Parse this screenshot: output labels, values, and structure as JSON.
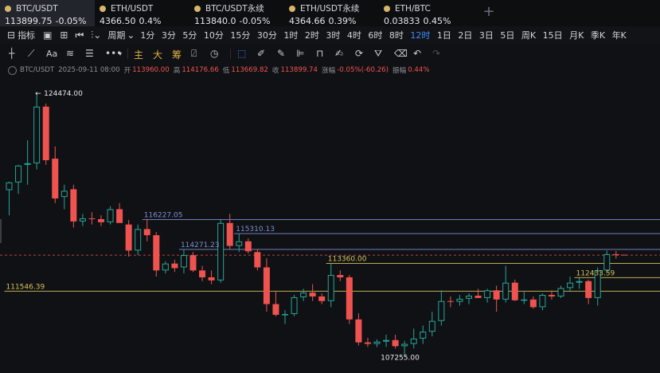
{
  "tickers": [
    {
      "symbol": "BTC/USDT",
      "price": "113899.75",
      "change": "-0.05%",
      "active": true
    },
    {
      "symbol": "ETH/USDT",
      "price": "4366.50",
      "change": "0.4%"
    },
    {
      "symbol": "BTC/USDT永续",
      "price": "113840.0",
      "change": "-0.05%"
    },
    {
      "symbol": "ETH/USDT永续",
      "price": "4364.66",
      "change": "0.39%"
    },
    {
      "symbol": "ETH/BTC",
      "price": "0.03833",
      "change": "0.45%"
    }
  ],
  "toolbar": {
    "indicators_label": "指标",
    "period_label": "周期",
    "intervals": [
      "1分",
      "3分",
      "5分",
      "10分",
      "15分",
      "30分",
      "1时",
      "2时",
      "3时",
      "4时",
      "6时",
      "8时",
      "12时",
      "1日",
      "2日",
      "3日",
      "5日",
      "周K",
      "15日",
      "月K",
      "季K",
      "年K"
    ],
    "active_interval": "12时"
  },
  "drawbar": {
    "text_labels": [
      "主",
      "大",
      "筹"
    ]
  },
  "legend": {
    "symbol": "BTC/USDT",
    "datetime": "2025-09-11 08:00",
    "open_label": "开",
    "open": "113960.00",
    "high_label": "高",
    "high": "114176.66",
    "low_label": "低",
    "low": "113669.82",
    "close_label": "收",
    "close": "113899.74",
    "change_label": "涨幅",
    "change": "-0.05%(-60.26)",
    "amplitude_label": "振幅",
    "amplitude": "0.44%"
  },
  "colors": {
    "up": "#26a69a",
    "down": "#ef5350",
    "accent": "#3f8cff",
    "level_gold": "#d4c15f",
    "level_blue": "#7d8fd1"
  },
  "chart_data": {
    "type": "candlestick",
    "interval": "12时",
    "series": [
      {
        "o": 118150,
        "h": 118700,
        "l": 116500,
        "c": 118650
      },
      {
        "o": 118650,
        "h": 119800,
        "l": 117900,
        "c": 119750
      },
      {
        "o": 119800,
        "h": 121400,
        "l": 118500,
        "c": 119900
      },
      {
        "o": 119900,
        "h": 124474,
        "l": 119500,
        "c": 123600
      },
      {
        "o": 123600,
        "h": 123800,
        "l": 119800,
        "c": 120100
      },
      {
        "o": 120200,
        "h": 121000,
        "l": 117300,
        "c": 117600
      },
      {
        "o": 117700,
        "h": 118500,
        "l": 116900,
        "c": 118100
      },
      {
        "o": 118200,
        "h": 118500,
        "l": 115700,
        "c": 116100
      },
      {
        "o": 116100,
        "h": 116600,
        "l": 115800,
        "c": 116300
      },
      {
        "o": 116300,
        "h": 116700,
        "l": 115900,
        "c": 116250
      },
      {
        "o": 116250,
        "h": 116500,
        "l": 115800,
        "c": 116050
      },
      {
        "o": 116050,
        "h": 117100,
        "l": 115900,
        "c": 116900
      },
      {
        "o": 116900,
        "h": 117300,
        "l": 116300,
        "c": 116000
      },
      {
        "o": 115900,
        "h": 116200,
        "l": 113800,
        "c": 114200
      },
      {
        "o": 114200,
        "h": 115900,
        "l": 113900,
        "c": 115600
      },
      {
        "o": 115600,
        "h": 116227,
        "l": 114800,
        "c": 115200
      },
      {
        "o": 115200,
        "h": 115400,
        "l": 112500,
        "c": 112900
      },
      {
        "o": 112900,
        "h": 113500,
        "l": 112700,
        "c": 113350
      },
      {
        "o": 113350,
        "h": 113600,
        "l": 112800,
        "c": 113050
      },
      {
        "o": 113100,
        "h": 114271,
        "l": 112700,
        "c": 113900
      },
      {
        "o": 113900,
        "h": 114100,
        "l": 112800,
        "c": 112900
      },
      {
        "o": 112900,
        "h": 113200,
        "l": 112200,
        "c": 112450
      },
      {
        "o": 112450,
        "h": 112900,
        "l": 112000,
        "c": 112250
      },
      {
        "o": 112250,
        "h": 116200,
        "l": 112100,
        "c": 116000
      },
      {
        "o": 116000,
        "h": 116600,
        "l": 114300,
        "c": 114500
      },
      {
        "o": 114500,
        "h": 115310,
        "l": 114100,
        "c": 114800
      },
      {
        "o": 114800,
        "h": 115000,
        "l": 114000,
        "c": 114150
      },
      {
        "o": 114100,
        "h": 114300,
        "l": 112900,
        "c": 113100
      },
      {
        "o": 113100,
        "h": 113700,
        "l": 110200,
        "c": 110700
      },
      {
        "o": 110700,
        "h": 111500,
        "l": 109900,
        "c": 110000
      },
      {
        "o": 110000,
        "h": 110300,
        "l": 109400,
        "c": 110050
      },
      {
        "o": 110050,
        "h": 111300,
        "l": 109900,
        "c": 111150
      },
      {
        "o": 111150,
        "h": 111700,
        "l": 110900,
        "c": 111450
      },
      {
        "o": 111450,
        "h": 112000,
        "l": 110900,
        "c": 111200
      },
      {
        "o": 111200,
        "h": 111400,
        "l": 110700,
        "c": 110900
      },
      {
        "o": 110900,
        "h": 113360,
        "l": 110500,
        "c": 112600
      },
      {
        "o": 112600,
        "h": 112900,
        "l": 112200,
        "c": 112450
      },
      {
        "o": 112450,
        "h": 112600,
        "l": 109400,
        "c": 109700
      },
      {
        "o": 109700,
        "h": 110100,
        "l": 108000,
        "c": 108200
      },
      {
        "o": 108200,
        "h": 108500,
        "l": 107900,
        "c": 108100
      },
      {
        "o": 108100,
        "h": 108400,
        "l": 107900,
        "c": 108250
      },
      {
        "o": 108250,
        "h": 108700,
        "l": 107900,
        "c": 108350
      },
      {
        "o": 108350,
        "h": 108700,
        "l": 107800,
        "c": 107950
      },
      {
        "o": 107950,
        "h": 108300,
        "l": 107255,
        "c": 108100
      },
      {
        "o": 108100,
        "h": 109100,
        "l": 107800,
        "c": 108450
      },
      {
        "o": 108450,
        "h": 109300,
        "l": 108100,
        "c": 108900
      },
      {
        "o": 108900,
        "h": 110200,
        "l": 108600,
        "c": 109600
      },
      {
        "o": 109600,
        "h": 111600,
        "l": 109300,
        "c": 110900
      },
      {
        "o": 110900,
        "h": 111200,
        "l": 110500,
        "c": 110850
      },
      {
        "o": 110850,
        "h": 111300,
        "l": 110600,
        "c": 111050
      },
      {
        "o": 111050,
        "h": 111400,
        "l": 110700,
        "c": 111250
      },
      {
        "o": 111250,
        "h": 111700,
        "l": 111100,
        "c": 111100
      },
      {
        "o": 111100,
        "h": 111700,
        "l": 110800,
        "c": 111600
      },
      {
        "o": 111600,
        "h": 111900,
        "l": 110200,
        "c": 111000
      },
      {
        "o": 111000,
        "h": 113200,
        "l": 110800,
        "c": 112100
      },
      {
        "o": 112100,
        "h": 112300,
        "l": 110900,
        "c": 110950
      },
      {
        "o": 110950,
        "h": 111500,
        "l": 110700,
        "c": 111000
      },
      {
        "o": 111000,
        "h": 111200,
        "l": 110400,
        "c": 110500
      },
      {
        "o": 110500,
        "h": 111400,
        "l": 110300,
        "c": 111300
      },
      {
        "o": 111300,
        "h": 111600,
        "l": 111000,
        "c": 111200
      },
      {
        "o": 111200,
        "h": 111900,
        "l": 111100,
        "c": 111750
      },
      {
        "o": 111750,
        "h": 112500,
        "l": 111500,
        "c": 112100
      },
      {
        "o": 112100,
        "h": 112433,
        "l": 111700,
        "c": 112200
      },
      {
        "o": 112200,
        "h": 112300,
        "l": 110700,
        "c": 111100
      },
      {
        "o": 111100,
        "h": 113100,
        "l": 110600,
        "c": 112900
      },
      {
        "o": 112900,
        "h": 114200,
        "l": 112700,
        "c": 113960
      },
      {
        "o": 113960,
        "h": 114176.66,
        "l": 113669.82,
        "c": 113899.74
      }
    ],
    "labels": {
      "high": "124474.00",
      "low": "107255.00",
      "levels": [
        {
          "value": "116227.05",
          "color": "#7d8fd1"
        },
        {
          "value": "115310.13",
          "color": "#7d8fd1"
        },
        {
          "value": "114271.23",
          "color": "#7d8fd1"
        },
        {
          "value": "113360.00",
          "color": "#d4c15f"
        },
        {
          "value": "112433.59",
          "color": "#d4c15f"
        },
        {
          "value": "111546.39",
          "color": "#d4c15f"
        }
      ]
    },
    "current_price": 113899.75,
    "ylim": [
      106200,
      126400
    ]
  }
}
